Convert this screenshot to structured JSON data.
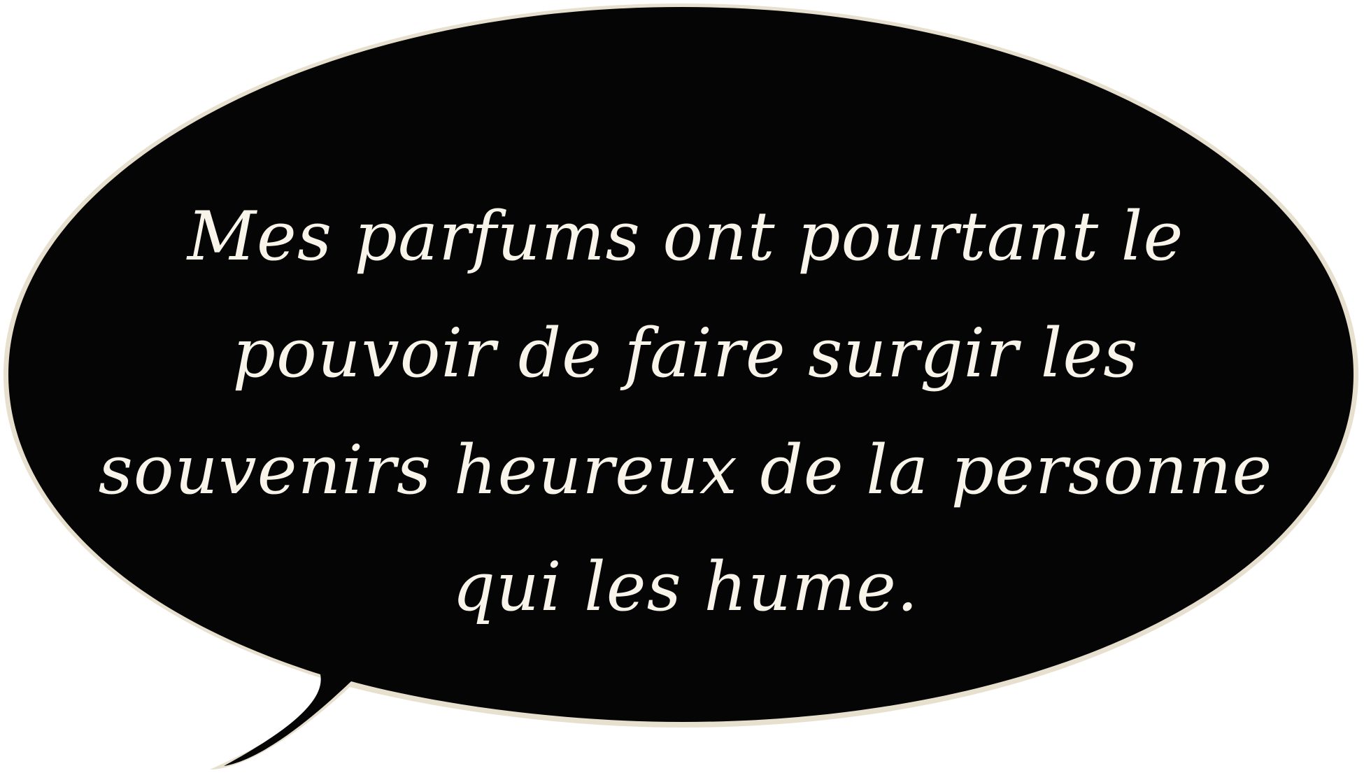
{
  "bubble": {
    "fill_color": "#050505",
    "outline_color": "#e8e0cf",
    "text_color": "#f8f4ea"
  },
  "quote": {
    "lines": [
      "Mes parfums ont pourtant le",
      "pouvoir de faire surgir les",
      "souvenirs heureux de la personne",
      "qui les hume."
    ]
  }
}
